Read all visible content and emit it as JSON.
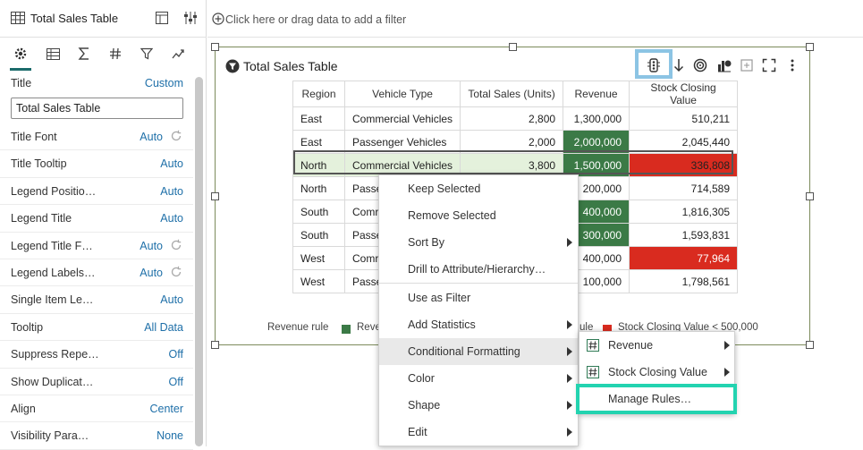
{
  "left_panel": {
    "header_title": "Total Sales Table",
    "tabs": [
      "general-icon",
      "table-icon",
      "sigma-icon",
      "hash-icon",
      "filter-icon",
      "analytics-icon"
    ],
    "title_label": "Title",
    "title_mode": "Custom",
    "title_value": "Total Sales Table",
    "props": [
      {
        "label": "Title Font",
        "value": "Auto",
        "reset": true
      },
      {
        "label": "Title Tooltip",
        "value": "Auto",
        "reset": false
      },
      {
        "label": "Legend Positio…",
        "value": "Auto",
        "reset": false
      },
      {
        "label": "Legend Title",
        "value": "Auto",
        "reset": false
      },
      {
        "label": "Legend Title F…",
        "value": "Auto",
        "reset": true
      },
      {
        "label": "Legend Labels…",
        "value": "Auto",
        "reset": true
      },
      {
        "label": "Single Item Le…",
        "value": "Auto",
        "reset": false
      },
      {
        "label": "Tooltip",
        "value": "All Data",
        "reset": false
      },
      {
        "label": "Suppress Repe…",
        "value": "Off",
        "reset": false
      },
      {
        "label": "Show Duplicat…",
        "value": "Off",
        "reset": false
      },
      {
        "label": "Align",
        "value": "Center",
        "reset": false
      },
      {
        "label": "Visibility Para…",
        "value": "None",
        "reset": false
      }
    ]
  },
  "filter_bar": {
    "text": "Click here or drag data to add a filter"
  },
  "viz": {
    "title": "Total Sales Table",
    "columns": [
      "Region",
      "Vehicle Type",
      "Total Sales (Units)",
      "Revenue",
      "Stock Closing Value"
    ],
    "rows": [
      {
        "region": "East",
        "vtype": "Commercial Vehicles",
        "units": "2,800",
        "revenue": "1,300,000",
        "stock": "510,211",
        "rev_fmt": "",
        "stock_fmt": ""
      },
      {
        "region": "East",
        "vtype": "Passenger Vehicles",
        "units": "2,000",
        "revenue": "2,000,000",
        "stock": "2,045,440",
        "rev_fmt": "green",
        "stock_fmt": ""
      },
      {
        "region": "North",
        "vtype": "Commercial Vehicles",
        "units": "3,800",
        "revenue": "1,500,000",
        "stock": "336,808",
        "rev_fmt": "green",
        "stock_fmt": "red"
      },
      {
        "region": "North",
        "vtype": "Passe",
        "units": "",
        "revenue": "200,000",
        "stock": "714,589",
        "rev_fmt": "",
        "stock_fmt": ""
      },
      {
        "region": "South",
        "vtype": "Comr",
        "units": "",
        "revenue": "400,000",
        "stock": "1,816,305",
        "rev_fmt": "green",
        "stock_fmt": ""
      },
      {
        "region": "South",
        "vtype": "Passe",
        "units": "",
        "revenue": "300,000",
        "stock": "1,593,831",
        "rev_fmt": "green",
        "stock_fmt": ""
      },
      {
        "region": "West",
        "vtype": "Comr",
        "units": "",
        "revenue": "400,000",
        "stock": "77,964",
        "rev_fmt": "",
        "stock_fmt": "red"
      },
      {
        "region": "West",
        "vtype": "Passe",
        "units": "",
        "revenue": "100,000",
        "stock": "1,798,561",
        "rev_fmt": "",
        "stock_fmt": ""
      }
    ],
    "legend": {
      "rule_label": "Revenue rule",
      "item1": "Reve",
      "item2_partial": "ule",
      "item3": "Stock Closing Value < 500,000"
    },
    "colors": {
      "green": "#3b7a46",
      "red": "#d92b1f",
      "selected_row": "#e4f1dc"
    }
  },
  "context_menu": {
    "items": [
      "Keep Selected",
      "Remove Selected",
      "Sort By",
      "Drill to Attribute/Hierarchy…",
      "Use as Filter",
      "Add Statistics",
      "Conditional Formatting",
      "Color",
      "Shape",
      "Edit"
    ]
  },
  "submenu": {
    "items": [
      "Revenue",
      "Stock Closing Value",
      "Manage Rules…"
    ]
  }
}
